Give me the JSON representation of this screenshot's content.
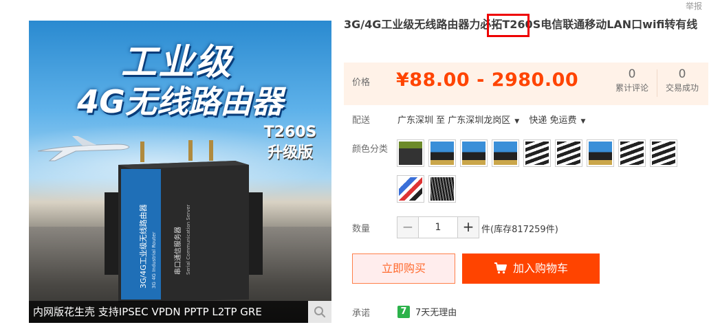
{
  "header": {
    "report_link": "举报"
  },
  "gallery": {
    "title_line1": "工业级",
    "title_line2": "4G无线路由器",
    "model_line1": "T260S",
    "model_line2": "升级版",
    "device_text_cn": "3G/4G工业级无线路由器",
    "device_text_en": "3G 4G Industrial Router",
    "device_text2_cn": "串口通信服务器",
    "device_text2_en": "Serial Communication Server",
    "bottom_caption": "内网版花生壳 支持IPSEC VPDN PPTP L2TP GRE",
    "zoom_icon": "search-icon"
  },
  "product": {
    "title": "3G/4G工业级无线路由器力必拓T260S电信联通移动LAN口wifi转有线",
    "price_label": "价格",
    "price": "¥88.00 - 2980.00",
    "reviews_count": "0",
    "reviews_label": "累计评论",
    "sales_count": "0",
    "sales_label": "交易成功",
    "shipping_label": "配送",
    "ship_from": "广东深圳 至",
    "ship_to": "广东深圳龙岗区",
    "ship_method": "快递 免运费",
    "color_label": "颜色分类",
    "swatch_count": 11,
    "quantity_label": "数量",
    "quantity_value": "1",
    "quantity_minus": "−",
    "quantity_plus": "+",
    "stock_text": "件(库存817259件)",
    "buy_now_label": "立即购买",
    "add_cart_label": "加入购物车",
    "promise_label": "承诺",
    "promise_badge": "7",
    "promise_text": "7天无理由"
  },
  "colors": {
    "price": "#ff4400",
    "highlight_box": "#ee0000",
    "promise_badge": "#2cb24a"
  }
}
